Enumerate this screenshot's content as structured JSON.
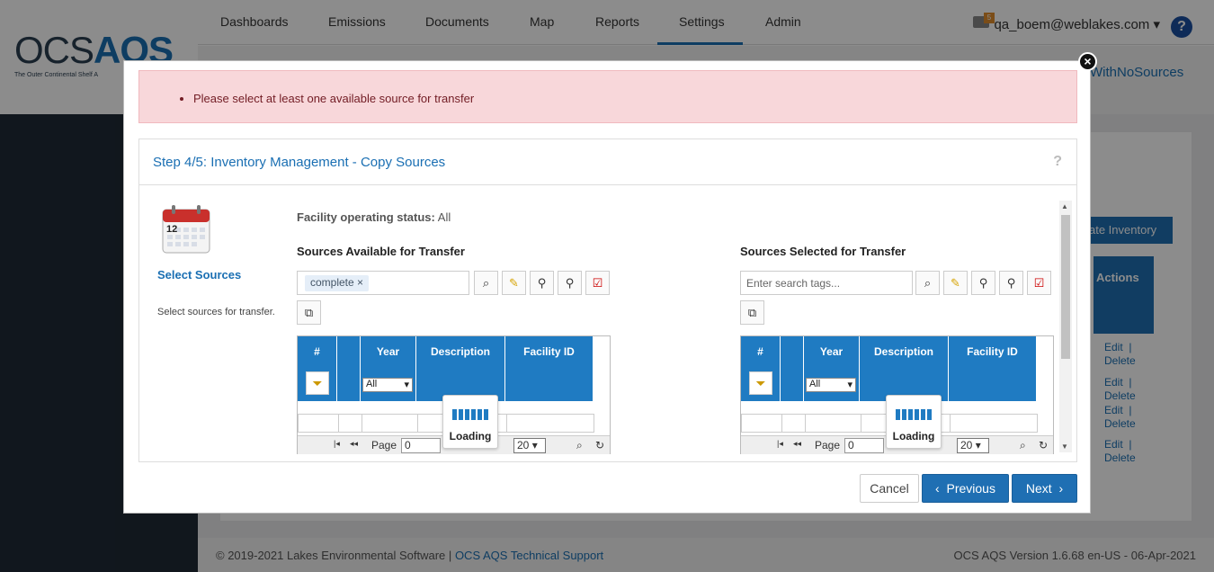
{
  "nav": {
    "items": [
      "Dashboards",
      "Emissions",
      "Documents",
      "Map",
      "Reports",
      "Settings",
      "Admin"
    ],
    "active": "Settings",
    "user": "qa_boem@weblakes.com",
    "mail_count": "5"
  },
  "logo": {
    "text_a": "OCS",
    "text_b": "AQS",
    "subtitle": "The Outer Continental Shelf A"
  },
  "background": {
    "link": "WithNoSources",
    "create_btn": "ate Inventory",
    "actions_header": "Actions",
    "edit": "Edit",
    "delete": "Delete",
    "separator": "|"
  },
  "footer": {
    "copyright": "© 2019-2021 Lakes Environmental Software",
    "sep": "|",
    "support_link": "OCS AQS Technical Support",
    "version": "OCS AQS Version 1.6.68 en-US - 06-Apr-2021"
  },
  "modal": {
    "alert": "Please select at least one available source for transfer",
    "wizard_title": "Step 4/5: Inventory Management - Copy Sources",
    "help": "?",
    "step_title": "Select Sources",
    "step_desc": "Select sources for transfer.",
    "calendar_day": "12",
    "facility_status_label": "Facility operating status:",
    "facility_status_value": "All",
    "available_title": "Sources Available for Transfer",
    "selected_title": "Sources Selected for Transfer",
    "tag_chip": "complete",
    "tag_placeholder": "Enter search tags...",
    "columns": [
      "#",
      "",
      "Year",
      "Description",
      "Facility ID"
    ],
    "year_filter": "All",
    "pager_label": "Page",
    "page_value": "0",
    "page_size": "20",
    "loading": "Loading",
    "cancel": "Cancel",
    "previous": "Previous",
    "next": "Next"
  },
  "colors": {
    "primary": "#1f6fb3",
    "grid_header": "#1f7bc2",
    "alert_bg": "#f8d7da"
  }
}
